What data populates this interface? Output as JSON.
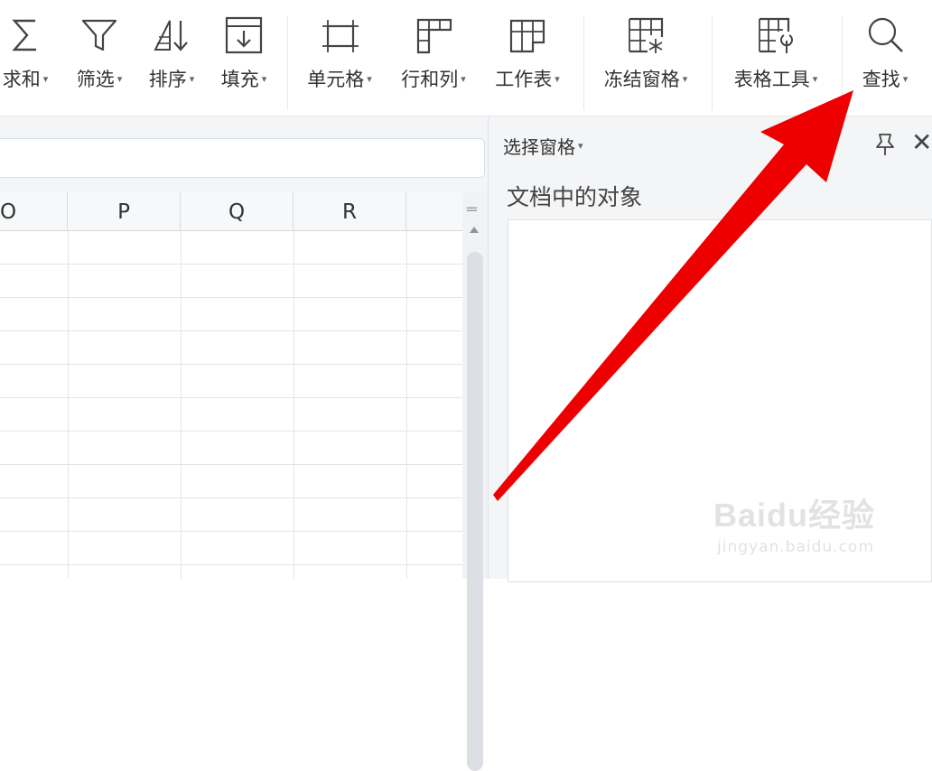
{
  "ribbon": {
    "tools": [
      {
        "label": "求和",
        "icon": "sum-icon"
      },
      {
        "label": "筛选",
        "icon": "filter-icon"
      },
      {
        "label": "排序",
        "icon": "sort-icon"
      },
      {
        "label": "填充",
        "icon": "fill-icon"
      },
      {
        "label": "单元格",
        "icon": "cell-icon"
      },
      {
        "label": "行和列",
        "icon": "rows-columns-icon"
      },
      {
        "label": "工作表",
        "icon": "worksheet-icon"
      },
      {
        "label": "冻结窗格",
        "icon": "freeze-panes-icon"
      },
      {
        "label": "表格工具",
        "icon": "table-tools-icon"
      },
      {
        "label": "查找",
        "icon": "search-icon"
      }
    ]
  },
  "sheet": {
    "columns": [
      "O",
      "P",
      "Q",
      "R"
    ]
  },
  "pane": {
    "title": "选择窗格",
    "section": "文档中的对象"
  },
  "watermark": {
    "brand": "Baidu经验",
    "url": "jingyan.baidu.com"
  },
  "colors": {
    "arrow": "#ee0000",
    "grid_line": "#e2e4e7"
  }
}
